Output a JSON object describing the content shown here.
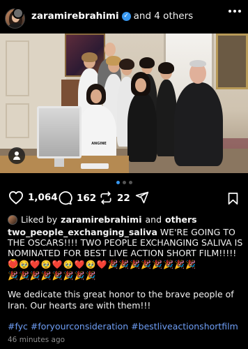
{
  "header": {
    "username": "zaramirebrahimi",
    "verified": true,
    "collaborators": "and 4 others"
  },
  "photo": {
    "tshirt_text": "ANGINE"
  },
  "carousel": {
    "count": 3,
    "active_index": 0
  },
  "actions": {
    "likes": "1,064",
    "comments": "162",
    "reposts": "22"
  },
  "liked_by": {
    "prefix": "Liked by",
    "user": "zaramirebrahimi",
    "connector": "and",
    "others": "others"
  },
  "caption": {
    "username": "two_people_exchanging_saliva",
    "text": " WE'RE GOING TO THE OSCARS!!!! TWO PEOPLE EXCHANGING SALIVA IS NOMINATED FOR BEST LIVE ACTION SHORT FILM!!!!! 🥹",
    "emoji_line_1": "❤️🥹❤️🥹❤️🥹❤️🥹❤️🎉🎉🎉🎉🎉🎉🎉🎉",
    "emoji_line_2": "🎉🎉🎉🎉🎉🎉🎉🎉",
    "paragraph_2": "We dedicate this great honor to the brave people of Iran. Our hearts are with them!!!",
    "hashtags": "#fyc #foryourconsideration #bestliveactionshortfilm"
  },
  "timestamp": "46 minutes ago",
  "colors": {
    "background": "#000000",
    "accent_blue": "#3797f0",
    "hashtag": "#6f9ff7",
    "muted": "#8e8e8e"
  },
  "icons": [
    "heart-icon",
    "comment-icon",
    "repost-icon",
    "share-icon",
    "bookmark-icon",
    "more-icon",
    "verified-icon",
    "user-tag-icon"
  ]
}
